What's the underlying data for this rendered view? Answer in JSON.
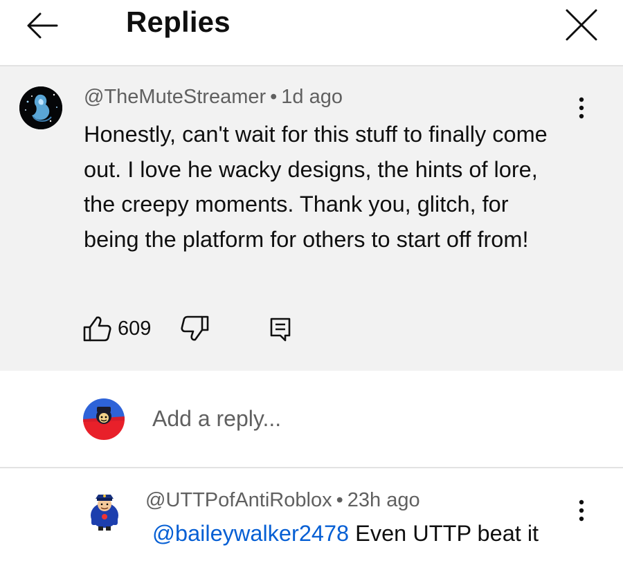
{
  "header": {
    "title": "Replies",
    "back_icon": "arrow-left-icon",
    "close_icon": "close-icon"
  },
  "comment": {
    "author": "@TheMuteStreamer",
    "separator": "•",
    "time": "1d ago",
    "text": "Honestly, can't wait for this stuff to finally come out. I love he wacky designs, the hints of lore, the creepy moments. Thank you, glitch, for being the platform for others to start off from!",
    "likes": "609",
    "icons": {
      "like": "thumbs-up-icon",
      "dislike": "thumbs-down-icon",
      "reply": "reply-icon",
      "menu": "more-vert-icon"
    }
  },
  "reply_box": {
    "placeholder": "Add a reply..."
  },
  "replies": [
    {
      "author": "@UTTPofAntiRoblox",
      "separator": "•",
      "time": "23h ago",
      "mention": "@baileywalker2478",
      "text": "Even UTTP beat it"
    }
  ],
  "colors": {
    "panel_bg": "#f2f2f2",
    "meta_text": "#606060",
    "mention_link": "#065fd4",
    "divider": "#e2e2e2"
  }
}
